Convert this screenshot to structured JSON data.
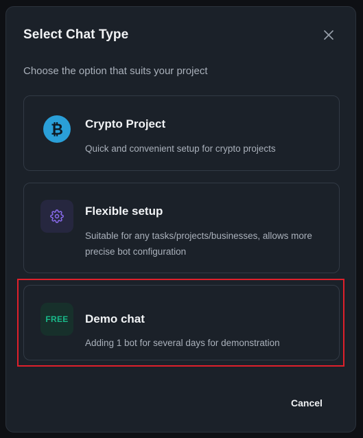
{
  "dialog": {
    "title": "Select Chat Type",
    "subtitle": "Choose the option that suits your project",
    "close_icon": "close-icon",
    "cancel_label": "Cancel"
  },
  "options": [
    {
      "icon": "bitcoin-icon",
      "title": "Crypto Project",
      "description": "Quick and convenient setup for crypto projects"
    },
    {
      "icon": "gear-icon",
      "title": "Flexible setup",
      "description": "Suitable for any tasks/projects/businesses, allows more precise bot configuration"
    },
    {
      "icon": "free-badge",
      "badge": "FREE",
      "title": "Demo chat",
      "description": "Adding 1 bot for several days for demonstration",
      "highlighted": true
    }
  ],
  "colors": {
    "background": "#1b2129",
    "card_border": "#323a45",
    "bitcoin": "#2a9fd8",
    "gear": "#8b6cf0",
    "free": "#19b98a",
    "highlight": "#e0202b"
  }
}
